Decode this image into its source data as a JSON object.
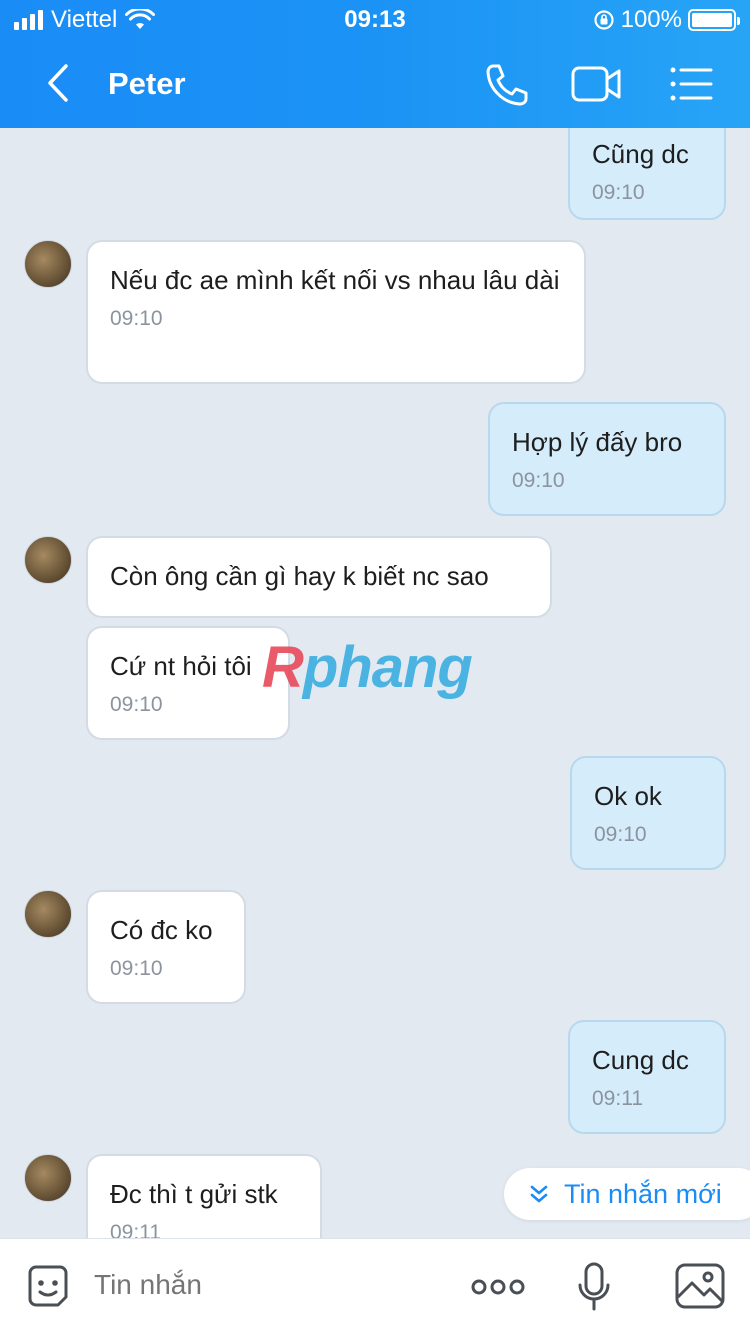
{
  "status_bar": {
    "carrier": "Viettel",
    "time": "09:13",
    "battery": "100%"
  },
  "header": {
    "contact_name": "Peter"
  },
  "messages": [
    {
      "dir": "out",
      "text": "Cũng dc",
      "time": "09:10"
    },
    {
      "dir": "in",
      "text": "Nếu đc ae mình kết nối vs nhau lâu dài",
      "time": "09:10"
    },
    {
      "dir": "out",
      "text": "Hợp lý đấy bro",
      "time": "09:10"
    },
    {
      "dir": "in",
      "text": "Còn ông cần gì hay k biết nc sao",
      "time": ""
    },
    {
      "dir": "in",
      "text": "Cứ nt hỏi tôi",
      "time": "09:10"
    },
    {
      "dir": "out",
      "text": "Ok ok",
      "time": "09:10"
    },
    {
      "dir": "in",
      "text": "Có đc ko",
      "time": "09:10"
    },
    {
      "dir": "out",
      "text": "Cung dc",
      "time": "09:11"
    },
    {
      "dir": "in",
      "text": "Đc thì t gửi stk",
      "time": "09:11"
    }
  ],
  "new_messages_label": "Tin nhắn mới",
  "watermark": {
    "first": "R",
    "rest": "phang"
  },
  "input": {
    "placeholder": "Tin nhắn"
  },
  "icons": {
    "back": "chevron-left-icon",
    "call": "phone-icon",
    "video": "video-camera-icon",
    "menu": "list-menu-icon",
    "emoji": "sticker-icon",
    "more": "more-dots-icon",
    "mic": "microphone-icon",
    "image": "image-icon",
    "new_messages": "double-chevron-down-icon"
  },
  "colors": {
    "header": "#1a8cf6",
    "outgoing_bubble": "#d5ecfb",
    "incoming_bubble": "#ffffff",
    "chat_background": "#e2e9f1",
    "accent": "#1a8cf6"
  }
}
